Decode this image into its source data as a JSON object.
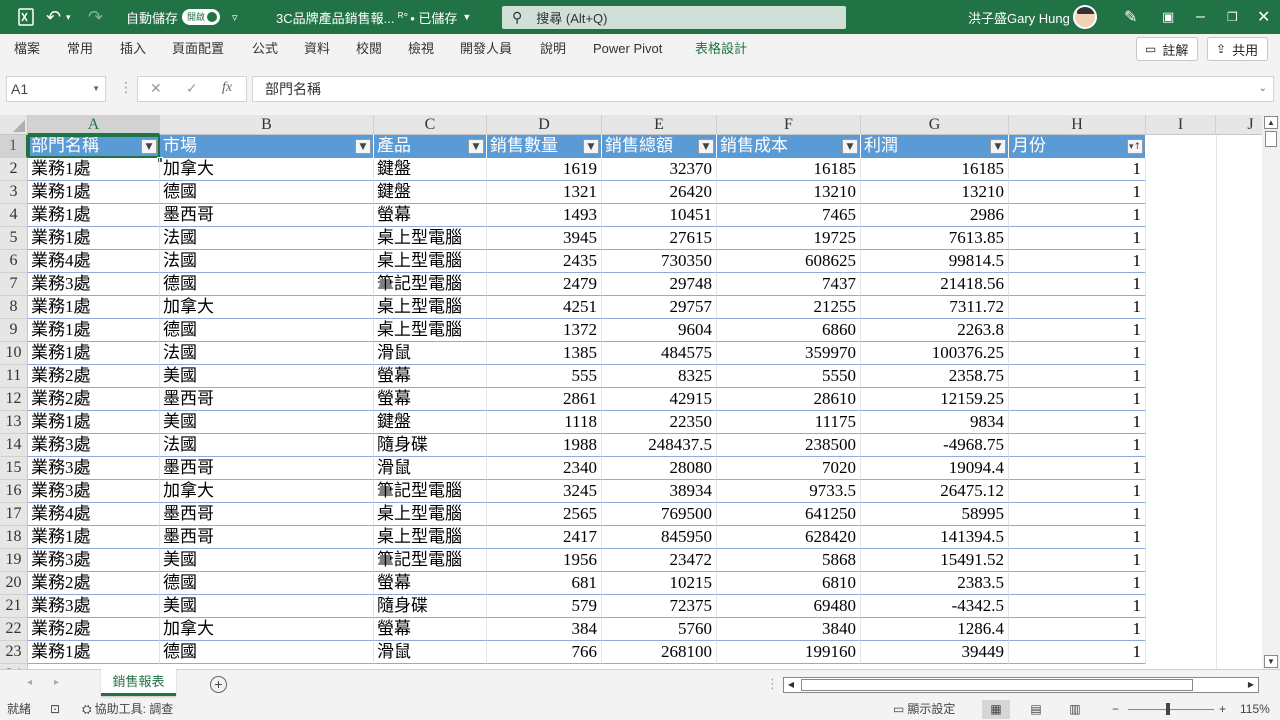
{
  "titlebar": {
    "autosave_label": "自動儲存",
    "autosave_state": "開啟",
    "filename": "3C品牌產品銷售報...",
    "save_status": "• 已儲存",
    "search_placeholder": "搜尋 (Alt+Q)",
    "user_name": "洪子盛Gary Hung"
  },
  "menu": {
    "items": [
      "檔案",
      "常用",
      "插入",
      "頁面配置",
      "公式",
      "資料",
      "校閱",
      "檢視",
      "開發人員",
      "說明",
      "Power Pivot",
      "表格設計"
    ],
    "active_index": 11,
    "comment_btn": "註解",
    "share_btn": "共用"
  },
  "formula_bar": {
    "name_box": "A1",
    "fx": "fx",
    "value": "部門名稱"
  },
  "columns": [
    "A",
    "B",
    "C",
    "D",
    "E",
    "F",
    "G",
    "H",
    "I",
    "J"
  ],
  "table": {
    "headers": [
      "部門名稱",
      "市場",
      "產品",
      "銷售數量",
      "銷售總額",
      "銷售成本",
      "利潤",
      "月份"
    ],
    "rows": [
      [
        "業務1處",
        "加拿大",
        "鍵盤",
        "1619",
        "32370",
        "16185",
        "16185",
        "1"
      ],
      [
        "業務1處",
        "德國",
        "鍵盤",
        "1321",
        "26420",
        "13210",
        "13210",
        "1"
      ],
      [
        "業務1處",
        "墨西哥",
        "螢幕",
        "1493",
        "10451",
        "7465",
        "2986",
        "1"
      ],
      [
        "業務1處",
        "法國",
        "桌上型電腦",
        "3945",
        "27615",
        "19725",
        "7613.85",
        "1"
      ],
      [
        "業務4處",
        "法國",
        "桌上型電腦",
        "2435",
        "730350",
        "608625",
        "99814.5",
        "1"
      ],
      [
        "業務3處",
        "德國",
        "筆記型電腦",
        "2479",
        "29748",
        "7437",
        "21418.56",
        "1"
      ],
      [
        "業務1處",
        "加拿大",
        "桌上型電腦",
        "4251",
        "29757",
        "21255",
        "7311.72",
        "1"
      ],
      [
        "業務1處",
        "德國",
        "桌上型電腦",
        "1372",
        "9604",
        "6860",
        "2263.8",
        "1"
      ],
      [
        "業務1處",
        "法國",
        "滑鼠",
        "1385",
        "484575",
        "359970",
        "100376.25",
        "1"
      ],
      [
        "業務2處",
        "美國",
        "螢幕",
        "555",
        "8325",
        "5550",
        "2358.75",
        "1"
      ],
      [
        "業務2處",
        "墨西哥",
        "螢幕",
        "2861",
        "42915",
        "28610",
        "12159.25",
        "1"
      ],
      [
        "業務1處",
        "美國",
        "鍵盤",
        "1118",
        "22350",
        "11175",
        "9834",
        "1"
      ],
      [
        "業務3處",
        "法國",
        "隨身碟",
        "1988",
        "248437.5",
        "238500",
        "-4968.75",
        "1"
      ],
      [
        "業務3處",
        "墨西哥",
        "滑鼠",
        "2340",
        "28080",
        "7020",
        "19094.4",
        "1"
      ],
      [
        "業務3處",
        "加拿大",
        "筆記型電腦",
        "3245",
        "38934",
        "9733.5",
        "26475.12",
        "1"
      ],
      [
        "業務4處",
        "墨西哥",
        "桌上型電腦",
        "2565",
        "769500",
        "641250",
        "58995",
        "1"
      ],
      [
        "業務1處",
        "墨西哥",
        "桌上型電腦",
        "2417",
        "845950",
        "628420",
        "141394.5",
        "1"
      ],
      [
        "業務3處",
        "美國",
        "筆記型電腦",
        "1956",
        "23472",
        "5868",
        "15491.52",
        "1"
      ],
      [
        "業務2處",
        "德國",
        "螢幕",
        "681",
        "10215",
        "6810",
        "2383.5",
        "1"
      ],
      [
        "業務3處",
        "美國",
        "隨身碟",
        "579",
        "72375",
        "69480",
        "-4342.5",
        "1"
      ],
      [
        "業務2處",
        "加拿大",
        "螢幕",
        "384",
        "5760",
        "3840",
        "1286.4",
        "1"
      ],
      [
        "業務1處",
        "德國",
        "滑鼠",
        "766",
        "268100",
        "199160",
        "39449",
        "1"
      ]
    ]
  },
  "sheet_tab": "銷售報表",
  "status": {
    "ready": "就緒",
    "accessibility": "協助工具: 調查",
    "display_settings": "顯示設定",
    "zoom": "115%"
  },
  "colors": {
    "brand": "#217346",
    "table_header": "#5b9bd5",
    "table_border": "#8eaadb"
  }
}
